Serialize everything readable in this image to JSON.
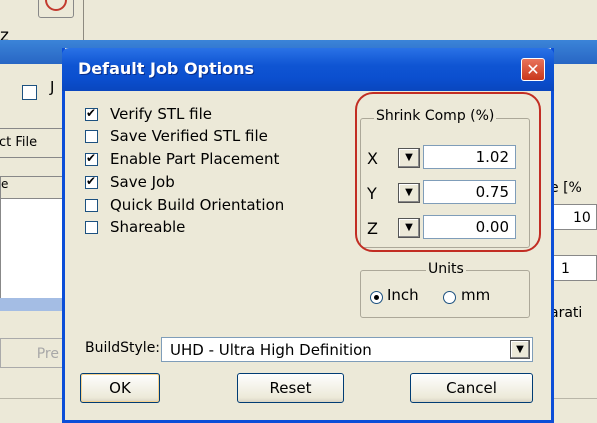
{
  "background": {
    "title_fragment": "z",
    "check_fragment": "J",
    "select_file_fragment": "ct File",
    "column_header_fragment": "e",
    "preview_fragment": "Pre",
    "right_header_fragment": "e [%",
    "right_value_1": "10",
    "right_value_2": "1",
    "right_text_fragment": "arati"
  },
  "dialog": {
    "title": "Default Job Options",
    "close_glyph": "✕",
    "options": [
      {
        "label": "Verify STL file",
        "checked": true
      },
      {
        "label": "Save Verified STL file",
        "checked": false
      },
      {
        "label": "Enable Part Placement",
        "checked": true
      },
      {
        "label": "Save Job",
        "checked": true
      },
      {
        "label": "Quick Build Orientation",
        "checked": false
      },
      {
        "label": "Shareable",
        "checked": false
      }
    ],
    "shrink_comp": {
      "legend": "Shrink Comp (%)",
      "axes": [
        {
          "label": "X",
          "value": "1.02"
        },
        {
          "label": "Y",
          "value": "0.75"
        },
        {
          "label": "Z",
          "value": "0.00"
        }
      ]
    },
    "units": {
      "legend": "Units",
      "options": [
        {
          "label": "Inch",
          "selected": true
        },
        {
          "label": "mm",
          "selected": false
        }
      ]
    },
    "build_style": {
      "label": "BuildStyle:",
      "value": "UHD - Ultra High Definition"
    },
    "buttons": {
      "ok": "OK",
      "reset": "Reset",
      "cancel": "Cancel"
    },
    "highlight_color": "#c22d23",
    "titlebar_color": "#0b4ed8"
  }
}
